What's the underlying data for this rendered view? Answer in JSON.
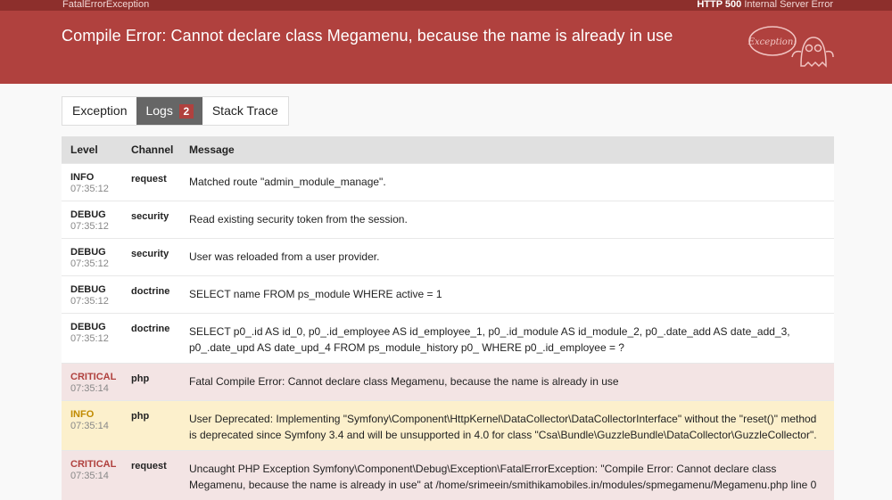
{
  "header": {
    "exception_class": "FatalErrorException",
    "http_status": "HTTP 500",
    "http_status_text": "Internal Server Error",
    "title": "Compile Error: Cannot declare class Megamenu, because the name is already in use",
    "mascot_text": "Exception!"
  },
  "tabs": [
    {
      "label": "Exception"
    },
    {
      "label": "Logs",
      "count": "2"
    },
    {
      "label": "Stack Trace"
    }
  ],
  "logs": {
    "columns": [
      "Level",
      "Channel",
      "Message"
    ],
    "rows": [
      {
        "level": "INFO",
        "time": "07:35:12",
        "channel": "request",
        "message": "Matched route \"admin_module_manage\"."
      },
      {
        "level": "DEBUG",
        "time": "07:35:12",
        "channel": "security",
        "message": "Read existing security token from the session."
      },
      {
        "level": "DEBUG",
        "time": "07:35:12",
        "channel": "security",
        "message": "User was reloaded from a user provider."
      },
      {
        "level": "DEBUG",
        "time": "07:35:12",
        "channel": "doctrine",
        "message": "SELECT name FROM ps_module WHERE active = 1"
      },
      {
        "level": "DEBUG",
        "time": "07:35:12",
        "channel": "doctrine",
        "message": "SELECT p0_.id AS id_0, p0_.id_employee AS id_employee_1, p0_.id_module AS id_module_2, p0_.date_add AS date_add_3, p0_.date_upd AS date_upd_4 FROM ps_module_history p0_ WHERE p0_.id_employee = ?"
      },
      {
        "level": "CRITICAL",
        "time": "07:35:14",
        "channel": "php",
        "message": "Fatal Compile Error: Cannot declare class Megamenu, because the name is already in use"
      },
      {
        "level": "INFO",
        "time": "07:35:14",
        "channel": "php",
        "message": "User Deprecated: Implementing \"Symfony\\Component\\HttpKernel\\DataCollector\\DataCollectorInterface\" without the \"reset()\" method is deprecated since Symfony 3.4 and will be unsupported in 4.0 for class \"Csa\\Bundle\\GuzzleBundle\\DataCollector\\GuzzleCollector\"."
      },
      {
        "level": "CRITICAL",
        "time": "07:35:14",
        "channel": "request",
        "message": "Uncaught PHP Exception Symfony\\Component\\Debug\\Exception\\FatalErrorException: \"Compile Error: Cannot declare class Megamenu, because the name is already in use\" at /home/srimeein/smithikamobiles.in/modules/spmegamenu/Megamenu.php line 0"
      }
    ]
  },
  "colors": {
    "header_bg": "#b0413e",
    "critical_row": "#f3e4e4",
    "warning_row": "#fcf0cc"
  }
}
